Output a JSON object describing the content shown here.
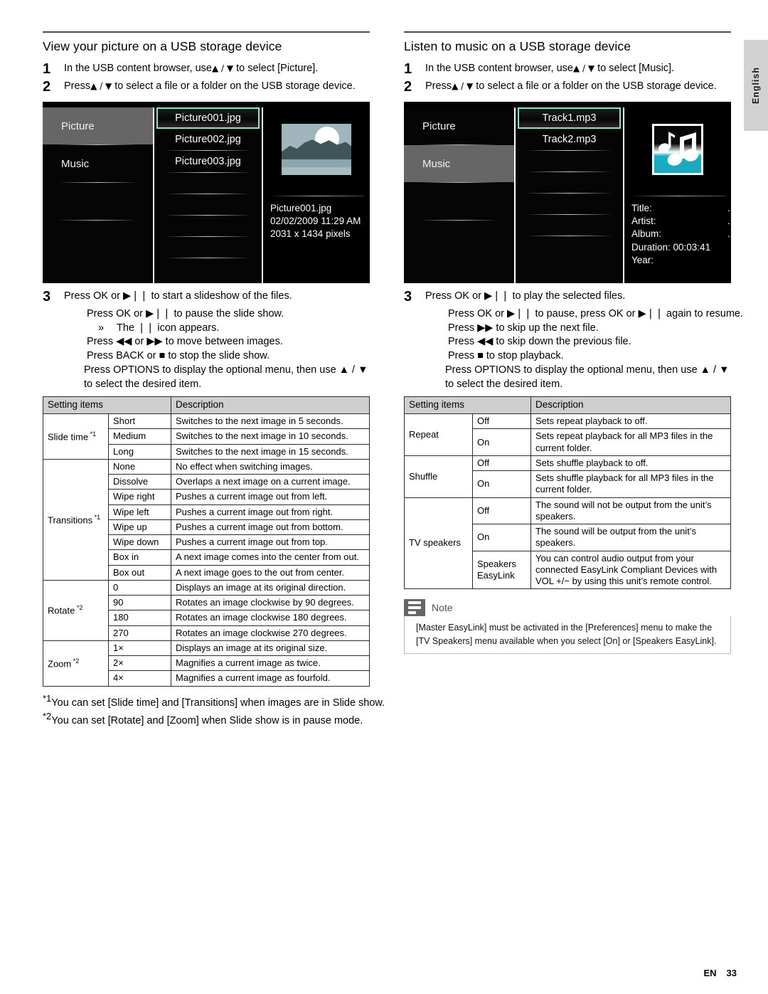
{
  "page": {
    "language_tab": "English",
    "footer_label": "EN",
    "footer_page": "33"
  },
  "left": {
    "title": "View your picture on a USB storage device",
    "steps": [
      {
        "num": "1",
        "text_before": "In the USB content browser, use",
        "glyph": "▲ / ▼",
        "text_after": " to select [Picture]."
      },
      {
        "num": "2",
        "text_before": "Press",
        "glyph": "▲ / ▼",
        "text_after": " to select a file or a folder on the USB storage device."
      }
    ],
    "tv": {
      "menu": [
        {
          "label": "Picture",
          "selected": true
        },
        {
          "label": "Music",
          "selected": false
        }
      ],
      "files": [
        {
          "label": "Picture001.jpg",
          "selected": true
        },
        {
          "label": "Picture002.jpg",
          "selected": false
        },
        {
          "label": "Picture003.jpg",
          "selected": false
        }
      ],
      "thumbnail_icon": "landscape-photo-thumbnail",
      "meta": [
        {
          "key": "Picture001.jpg",
          "value": ""
        },
        {
          "key": "02/02/2009 11:29 AM",
          "value": ""
        },
        {
          "key": "2031 x 1434 pixels",
          "value": ""
        }
      ]
    },
    "step3": {
      "num": "3",
      "line1": "Press OK or ▶❘❘ to start a slideshow of the files.",
      "line2": "Press OK or ▶❘❘ to pause the slide show.",
      "bullet_marker": "»",
      "bullet": "The ❘❘ icon appears.",
      "line3": "Press ◀◀ or ▶▶ to move between images.",
      "line4": "Press BACK or ■ to stop the slide show.",
      "line5a": "Press OPTIONS to display the optional menu, then use ▲ / ▼",
      "line5b": "to select the desired item."
    },
    "table": {
      "headers": [
        "Setting items",
        "Description"
      ],
      "groups": [
        {
          "category": "Slide time",
          "note": "*1",
          "rows": [
            {
              "option": "Short",
              "description": "Switches to the next image in 5 seconds."
            },
            {
              "option": "Medium",
              "description": "Switches to the next image in 10 seconds."
            },
            {
              "option": "Long",
              "description": "Switches to the next image in 15 seconds."
            }
          ]
        },
        {
          "category": "Transitions",
          "note": "*1",
          "rows": [
            {
              "option": "None",
              "description": "No effect when switching images."
            },
            {
              "option": "Dissolve",
              "description": "Overlaps a next image on a current image."
            },
            {
              "option": "Wipe right",
              "description": "Pushes a current image out from left."
            },
            {
              "option": "Wipe left",
              "description": "Pushes a current image out from right."
            },
            {
              "option": "Wipe up",
              "description": "Pushes a current image out from bottom."
            },
            {
              "option": "Wipe down",
              "description": "Pushes a current image out from top."
            },
            {
              "option": "Box in",
              "description": "A next image comes into the center from out."
            },
            {
              "option": "Box out",
              "description": "A next image goes to the out from center."
            }
          ]
        },
        {
          "category": "Rotate",
          "note": "*2",
          "rows": [
            {
              "option": "0",
              "description": "Displays an image at its original direction."
            },
            {
              "option": "90",
              "description": "Rotates an image clockwise by 90 degrees."
            },
            {
              "option": "180",
              "description": "Rotates an image clockwise 180 degrees."
            },
            {
              "option": "270",
              "description": "Rotates an image clockwise 270 degrees."
            }
          ]
        },
        {
          "category": "Zoom",
          "note": "*2",
          "rows": [
            {
              "option": "1×",
              "description": "Displays an image at its original size."
            },
            {
              "option": "2×",
              "description": "Magnifies a current image as twice."
            },
            {
              "option": "4×",
              "description": "Magnifies a current image as fourfold."
            }
          ]
        }
      ]
    },
    "footnotes": [
      {
        "marker": "*1",
        "text": "You can set [Slide time] and [Transitions] when images are in Slide show."
      },
      {
        "marker": "*2",
        "text": "You can set [Rotate] and [Zoom] when Slide show is in pause mode."
      }
    ]
  },
  "right": {
    "title": "Listen to music on a USB storage device",
    "steps": [
      {
        "num": "1",
        "text_before": "In the USB content browser, use",
        "glyph": "▲ / ▼",
        "text_after": " to select [Music]."
      },
      {
        "num": "2",
        "text_before": "Press",
        "glyph": "▲ / ▼",
        "text_after": " to select a file or a folder on the USB storage device."
      }
    ],
    "tv": {
      "menu": [
        {
          "label": "Picture",
          "selected": false
        },
        {
          "label": "Music",
          "selected": true
        }
      ],
      "files": [
        {
          "label": "Track1.mp3",
          "selected": true
        },
        {
          "label": "Track2.mp3",
          "selected": false
        }
      ],
      "thumbnail_icon": "music-notes-thumbnail",
      "meta": [
        {
          "key": "Title:",
          "value": "..."
        },
        {
          "key": "Artist:",
          "value": "..."
        },
        {
          "key": "Album:",
          "value": "..."
        },
        {
          "key": "Duration: 00:03:41",
          "value": ""
        },
        {
          "key": "Year:",
          "value": ""
        }
      ]
    },
    "step3": {
      "num": "3",
      "line1": "Press OK or ▶❘❘ to play the selected files.",
      "line2": "Press OK or ▶❘❘ to pause, press OK or ▶❘❘ again to resume.",
      "line3": "Press ▶▶ to skip up the next file.",
      "line4": "Press ◀◀ to skip down the previous file.",
      "line5": "Press ■ to stop playback.",
      "line6a": "Press OPTIONS to display the optional menu, then use ▲ / ▼",
      "line6b": "to select the desired item."
    },
    "table": {
      "headers": [
        "Setting items",
        "Description"
      ],
      "groups": [
        {
          "category": "Repeat",
          "note": "",
          "rows": [
            {
              "option": "Off",
              "description": "Sets repeat playback to off."
            },
            {
              "option": "On",
              "description": "Sets repeat playback for all MP3 files in the current folder."
            }
          ]
        },
        {
          "category": "Shuffle",
          "note": "",
          "rows": [
            {
              "option": "Off",
              "description": "Sets shuffle playback to off."
            },
            {
              "option": "On",
              "description": "Sets shuffle playback for all MP3 files in the current folder."
            }
          ]
        },
        {
          "category": "TV speakers",
          "note": "",
          "rows": [
            {
              "option": "Off",
              "description": "The sound will not be output from the unit’s speakers."
            },
            {
              "option": "On",
              "description": "The sound will be output from the unit’s speakers."
            },
            {
              "option": "Speakers EasyLink",
              "description": "You can control audio output from your connected EasyLink Compliant Devices with VOL +/− by using this unit’s remote control."
            }
          ]
        }
      ]
    },
    "note": {
      "title": "Note",
      "line1": "[Master EasyLink] must be activated in the [Preferences] menu to make the",
      "line2": "[TV Speakers] menu available when you select [On] or [Speakers EasyLink]."
    }
  }
}
